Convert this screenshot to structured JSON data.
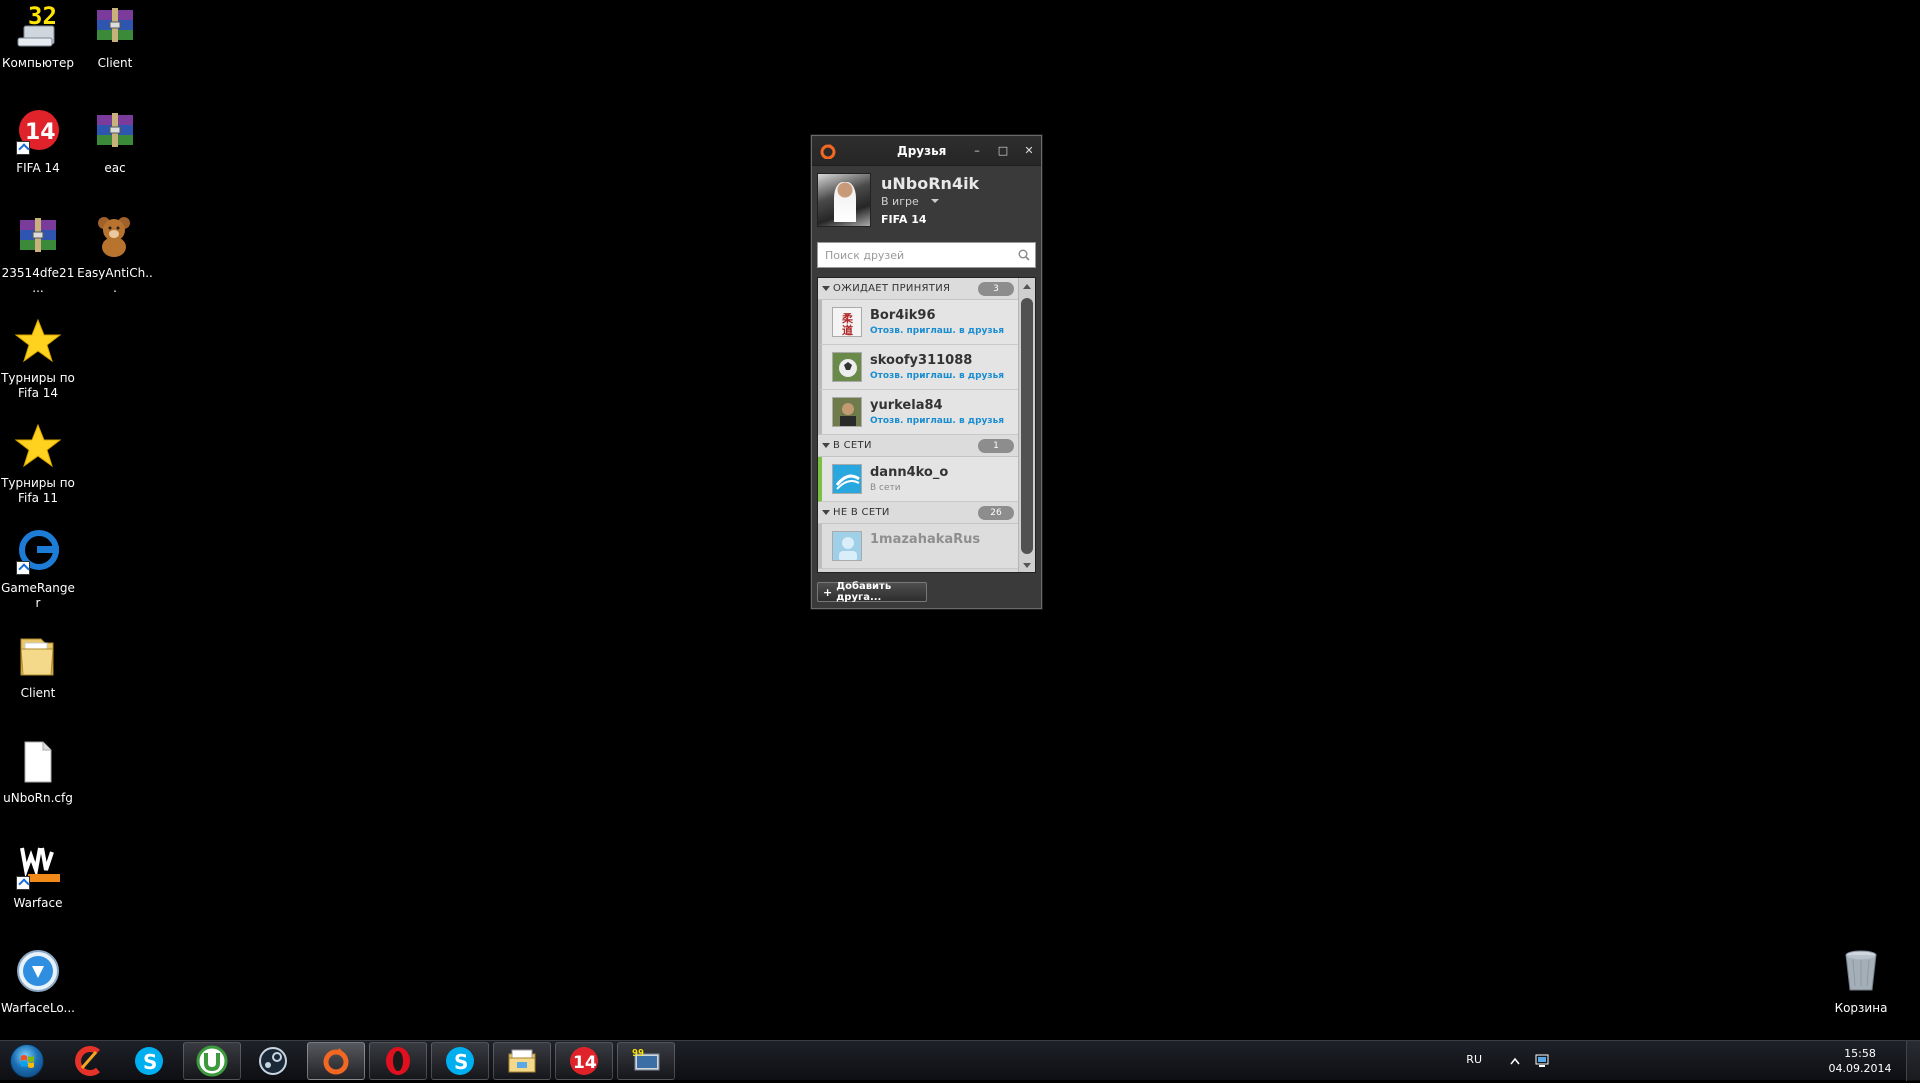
{
  "desktop": {
    "icons": [
      {
        "label": "Компьютер",
        "icon": "computer-icon"
      },
      {
        "label": "Client",
        "icon": "winrar-archive-icon"
      },
      {
        "label": "FIFA 14",
        "icon": "fifa14-icon"
      },
      {
        "label": "eac",
        "icon": "winrar-archive-icon"
      },
      {
        "label": "23514dfe21...",
        "icon": "winrar-archive-icon"
      },
      {
        "label": "EasyAntiCh...",
        "icon": "teddy-bear-icon"
      },
      {
        "label": "Турниры по Fifa 14",
        "icon": "star-icon"
      },
      {
        "label": "Турниры по Fifa 11",
        "icon": "star-icon"
      },
      {
        "label": "GameRanger",
        "icon": "gameranger-icon"
      },
      {
        "label": "Client",
        "icon": "folder-icon"
      },
      {
        "label": "uNboRn.cfg",
        "icon": "file-icon"
      },
      {
        "label": "Warface",
        "icon": "warface-icon"
      },
      {
        "label": "WarfaceLo...",
        "icon": "download-icon"
      },
      {
        "label": "Корзина",
        "icon": "recycle-bin-icon"
      }
    ],
    "computer_badge": "32"
  },
  "friends_window": {
    "title": "Друзья",
    "controls": {
      "minimize": "–",
      "maximize": "□",
      "close": "✕"
    },
    "profile": {
      "username": "uNboRn4ik",
      "status": "В игре",
      "game": "FIFA 14"
    },
    "search": {
      "placeholder": "Поиск друзей",
      "value": ""
    },
    "groups": [
      {
        "name": "ОЖИДАЕТ ПРИНЯТИЯ",
        "count": "3",
        "friends": [
          {
            "name": "Bor4ik96",
            "sub": "Отозв. приглаш. в друзья",
            "avatar_colors": [
              "#f4f4f4",
              "#b02a2a"
            ]
          },
          {
            "name": "skoofy311088",
            "sub": "Отозв. приглаш. в друзья",
            "avatar_colors": [
              "#6a8a4a",
              "#eeeeee"
            ]
          },
          {
            "name": "yurkela84",
            "sub": "Отозв. приглаш. в друзья",
            "avatar_colors": [
              "#6f7b4a",
              "#c49a72"
            ]
          }
        ]
      },
      {
        "name": "В СЕТИ",
        "count": "1",
        "friends": [
          {
            "name": "dann4ko_o",
            "sub": "В сети",
            "avatar_colors": [
              "#29a7df",
              "#ffffff"
            ]
          }
        ]
      },
      {
        "name": "НЕ В СЕТИ",
        "count": "26",
        "friends": [
          {
            "name": "1mazahakaRus",
            "sub": "",
            "avatar_colors": [
              "#9fd0e8",
              "#d9eef8"
            ]
          }
        ]
      }
    ],
    "add_friend_label": "Добавить друга..."
  },
  "taskbar": {
    "apps": [
      {
        "name": "ccleaner-icon",
        "state": "none"
      },
      {
        "name": "skype-icon",
        "state": "none"
      },
      {
        "name": "utorrent-icon",
        "state": "open"
      },
      {
        "name": "steam-icon",
        "state": "none"
      },
      {
        "name": "origin-icon",
        "state": "active"
      },
      {
        "name": "opera-icon",
        "state": "open"
      },
      {
        "name": "skype-icon",
        "state": "open"
      },
      {
        "name": "explorer-icon",
        "state": "open"
      },
      {
        "name": "fifa14-icon",
        "state": "open"
      },
      {
        "name": "computer-icon",
        "state": "open"
      }
    ],
    "language": "RU",
    "time": "15:58",
    "date": "04.09.2014"
  },
  "colors": {
    "origin_orange": "#f26722",
    "online_green": "#7bc043",
    "link_blue": "#1a8dd1"
  }
}
